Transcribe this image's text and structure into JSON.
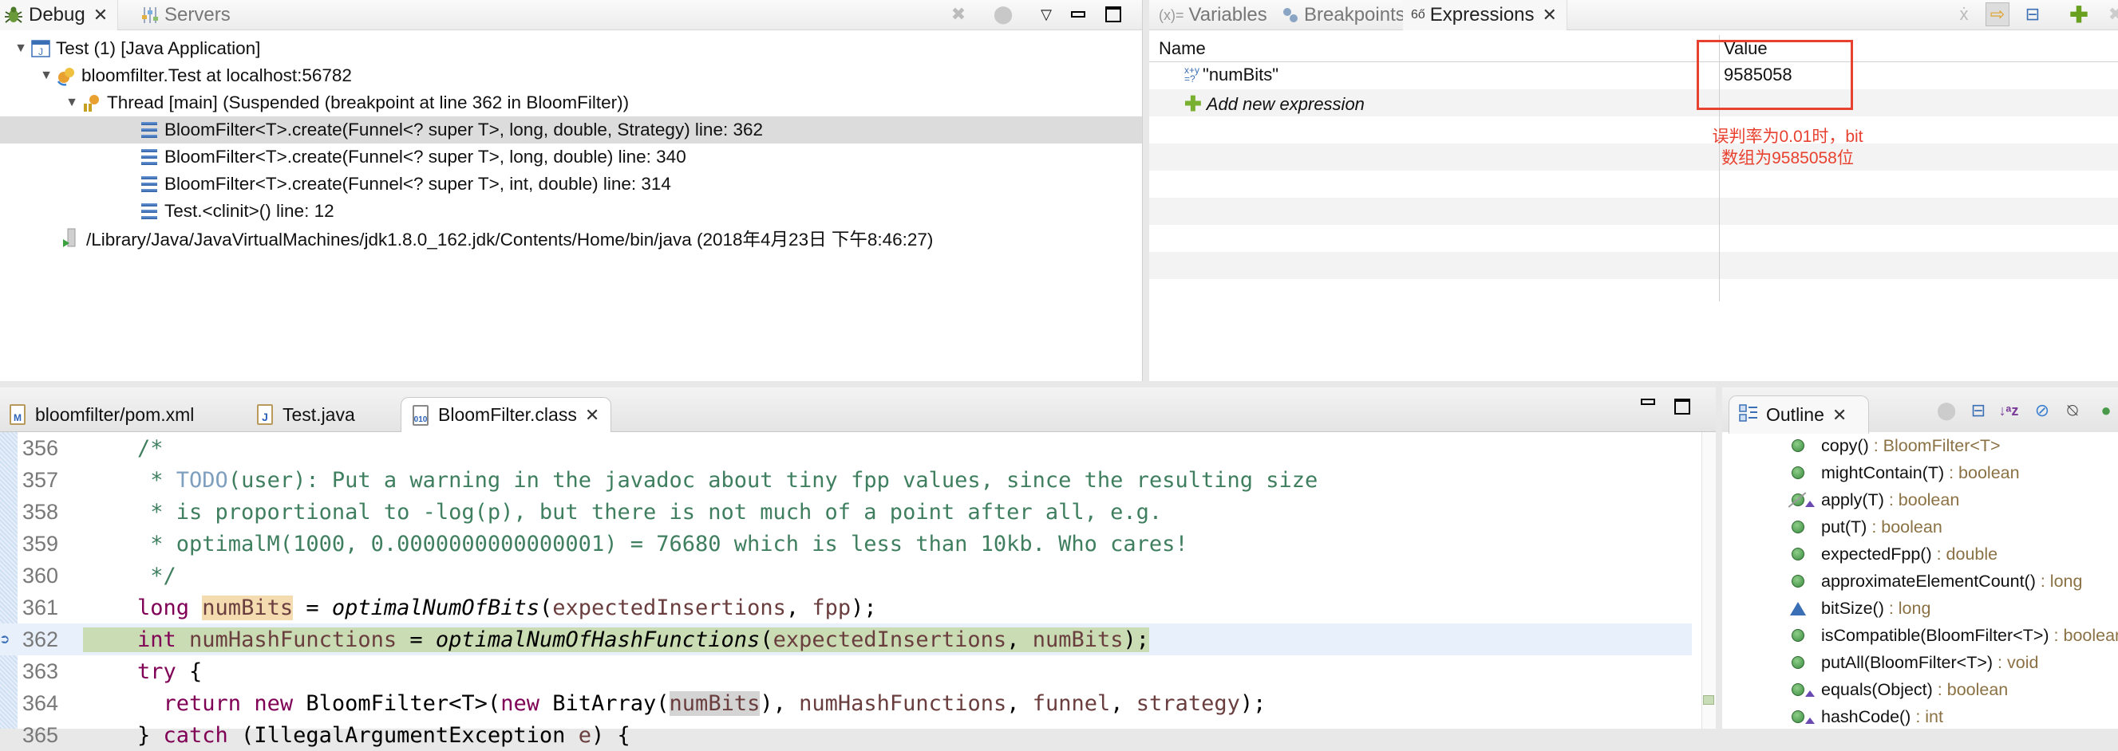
{
  "debug_view": {
    "tabs": [
      {
        "label": "Debug",
        "icon": "bug-icon",
        "active": true,
        "closable": true
      },
      {
        "label": "Servers",
        "icon": "servers-icon",
        "active": false
      }
    ],
    "toolbar": [
      {
        "icon": "remove-terminated-icon",
        "enabled": false
      },
      {
        "icon": "connect-icon",
        "enabled": false
      },
      {
        "icon": "view-menu-icon"
      },
      {
        "icon": "minimize-icon"
      },
      {
        "icon": "maximize-icon"
      }
    ],
    "tree": [
      {
        "label": "Test (1) [Java Application]",
        "icon": "java-app-icon",
        "level": 0,
        "expanded": true
      },
      {
        "label": "bloomfilter.Test at localhost:56782",
        "icon": "debug-target-icon",
        "level": 1,
        "expanded": true
      },
      {
        "label": "Thread [main] (Suspended (breakpoint at line 362 in BloomFilter))",
        "icon": "thread-suspended-icon",
        "level": 2,
        "expanded": true
      },
      {
        "label": "BloomFilter<T>.create(Funnel<? super T>, long, double, Strategy) line: 362",
        "icon": "stack-frame-icon",
        "level": 3,
        "selected": true
      },
      {
        "label": "BloomFilter<T>.create(Funnel<? super T>, long, double) line: 340",
        "icon": "stack-frame-icon",
        "level": 3
      },
      {
        "label": "BloomFilter<T>.create(Funnel<? super T>, int, double) line: 314",
        "icon": "stack-frame-icon",
        "level": 3
      },
      {
        "label": "Test.<clinit>() line: 12",
        "icon": "stack-frame-icon",
        "level": 3
      },
      {
        "label": "/Library/Java/JavaVirtualMachines/jdk1.8.0_162.jdk/Contents/Home/bin/java (2018年4月23日 下午8:46:27)",
        "icon": "process-icon",
        "level": 1
      }
    ]
  },
  "expressions_view": {
    "tabs": [
      {
        "label": "Variables",
        "icon": "variables-icon",
        "prefix": "(x)=",
        "active": false
      },
      {
        "label": "Breakpoints",
        "icon": "breakpoints-icon",
        "active": false
      },
      {
        "label": "Expressions",
        "icon": "expressions-icon",
        "active": true,
        "closable": true
      }
    ],
    "toolbar": [
      {
        "icon": "show-type-names-icon",
        "enabled": false
      },
      {
        "icon": "show-logical-structure-icon",
        "pressed": true
      },
      {
        "icon": "collapse-all-icon"
      },
      {
        "icon": "add-expression-icon"
      },
      {
        "icon": "remove-expression-icon",
        "enabled": false
      }
    ],
    "columns": {
      "name": "Name",
      "value": "Value"
    },
    "rows": [
      {
        "name": "\"numBits\"",
        "value": "9585058",
        "icon": "watch-expression-icon"
      },
      {
        "name": "Add new expression",
        "value": "",
        "icon": "add-icon",
        "italic": true
      }
    ],
    "annotation": {
      "line1": "误判率为0.01时，bit",
      "line2": "数组为9585058位",
      "color": "#e8412f"
    }
  },
  "editor": {
    "tabs": [
      {
        "label": "bloomfilter/pom.xml",
        "icon": "maven-file-icon",
        "active": false
      },
      {
        "label": "Test.java",
        "icon": "java-file-icon",
        "active": false
      },
      {
        "label": "BloomFilter.class",
        "icon": "class-file-icon",
        "active": true,
        "closable": true
      }
    ],
    "current_line": 362,
    "lines": [
      {
        "num": "356",
        "text": "/*"
      },
      {
        "num": "357",
        "text": " * TODO(user): Put a warning in the javadoc about tiny fpp values, since the resulting size"
      },
      {
        "num": "358",
        "text": " * is proportional to -log(p), but there is not much of a point after all, e.g."
      },
      {
        "num": "359",
        "text": " * optimalM(1000, 0.0000000000000001) = 76680 which is less than 10kb. Who cares!"
      },
      {
        "num": "360",
        "text": " */"
      },
      {
        "num": "361",
        "text": "long numBits = optimalNumOfBits(expectedInsertions, fpp);"
      },
      {
        "num": "362",
        "text": "int numHashFunctions = optimalNumOfHashFunctions(expectedInsertions, numBits);"
      },
      {
        "num": "363",
        "text": "try {"
      },
      {
        "num": "364",
        "text": "  return new BloomFilter<T>(new BitArray(numBits), numHashFunctions, funnel, strategy);"
      },
      {
        "num": "365",
        "text": "} catch (IllegalArgumentException e) {"
      }
    ],
    "tokens": {
      "l356": [
        "/*"
      ],
      "l357": [
        " * ",
        "TODO",
        "(user): Put a warning in the javadoc about tiny fpp values, since the resulting size"
      ],
      "l358": [
        " * is proportional to -log(p), but there is not much of a point after all, e.g."
      ],
      "l359": [
        " * optimalM(1000, 0.0000000000000001) = 76680 which is less than 10kb. Who cares!"
      ],
      "l360": [
        " */"
      ],
      "l361": [
        "long",
        " ",
        "numBits",
        " = ",
        "optimalNumOfBits",
        "(",
        "expectedInsertions",
        ", ",
        "fpp",
        ");"
      ],
      "l362": [
        "int",
        " ",
        "numHashFunctions",
        " = ",
        "optimalNumOfHashFunctions",
        "(",
        "expectedInsertions",
        ", ",
        "numBits",
        ");"
      ],
      "l363": [
        "try",
        " {"
      ],
      "l364": [
        "  ",
        "return",
        " ",
        "new",
        " BloomFilter<T>(",
        "new",
        " BitArray(",
        "numBits",
        "), ",
        "numHashFunctions",
        ", ",
        "funnel",
        ", ",
        "strategy",
        ");"
      ],
      "l365": [
        "} ",
        "catch",
        " (IllegalArgumentException ",
        "e",
        ") {"
      ]
    }
  },
  "outline_view": {
    "tab": {
      "label": "Outline",
      "icon": "outline-icon",
      "closable": true
    },
    "toolbar": [
      {
        "icon": "focus-active-task-icon",
        "enabled": false
      },
      {
        "icon": "collapse-all-icon"
      },
      {
        "icon": "sort-icon"
      },
      {
        "icon": "hide-fields-icon"
      },
      {
        "icon": "hide-static-icon"
      },
      {
        "icon": "hide-non-public-icon"
      }
    ],
    "items": [
      {
        "name": "copy()",
        "type": " : BloomFilter<T>",
        "icon": "public-method-icon"
      },
      {
        "name": "mightContain(T)",
        "type": " : boolean",
        "icon": "public-method-icon"
      },
      {
        "name": "apply(T)",
        "type": " : boolean",
        "icon": "deprecated-method-icon",
        "override": true
      },
      {
        "name": "put(T)",
        "type": " : boolean",
        "icon": "public-method-icon"
      },
      {
        "name": "expectedFpp()",
        "type": " : double",
        "icon": "public-method-icon"
      },
      {
        "name": "approximateElementCount()",
        "type": " : long",
        "icon": "public-method-icon"
      },
      {
        "name": "bitSize()",
        "type": " : long",
        "icon": "default-method-icon"
      },
      {
        "name": "isCompatible(BloomFilter<T>)",
        "type": " : boolean",
        "icon": "public-method-icon"
      },
      {
        "name": "putAll(BloomFilter<T>)",
        "type": " : void",
        "icon": "public-method-icon"
      },
      {
        "name": "equals(Object)",
        "type": " : boolean",
        "icon": "public-method-icon",
        "override": true
      },
      {
        "name": "hashCode()",
        "type": " : int",
        "icon": "public-method-icon",
        "override": true
      }
    ]
  }
}
